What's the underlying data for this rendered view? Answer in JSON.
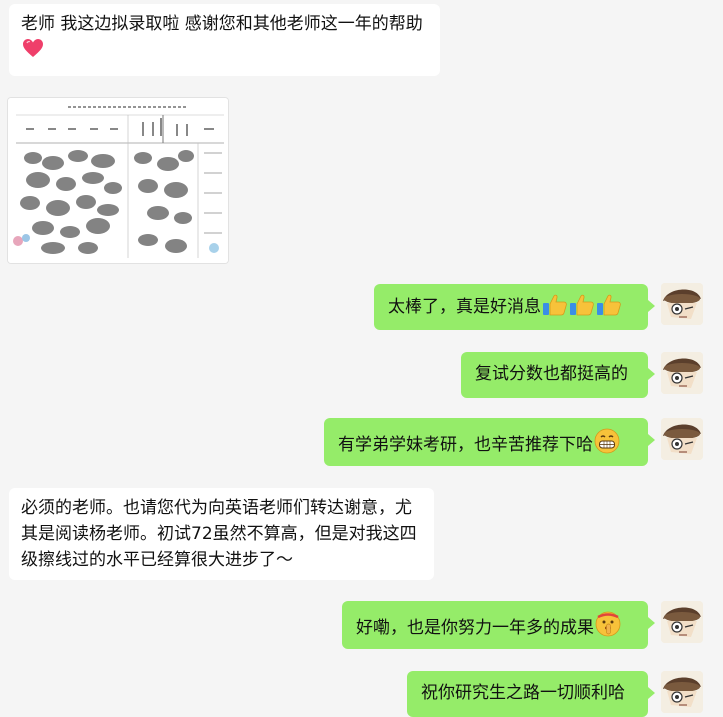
{
  "chat": {
    "messages": [
      {
        "side": "left",
        "text": "老师 我这边拟录取啦 感谢您和其他老师这一年的帮助",
        "emoji": "heart-icon"
      },
      {
        "side": "left",
        "type": "image",
        "image": "document-scan-thumbnail"
      },
      {
        "side": "right",
        "text": "太棒了，真是好消息",
        "emoji": "thumbs-up-icon x3"
      },
      {
        "side": "right",
        "text": "复试分数也都挺高的"
      },
      {
        "side": "right",
        "text": "有学弟学妹考研，也辛苦推荐下哈",
        "emoji": "grinning-face-icon"
      },
      {
        "side": "left",
        "text": "必须的老师。也请您代为向英语老师们转达谢意，尤其是阅读杨老师。初试72虽然不算高，但是对我这四级擦线过的水平已经算很大进步了～"
      },
      {
        "side": "right",
        "text": "好嘞，也是你努力一年多的成果",
        "emoji": "shushing-face-icon"
      },
      {
        "side": "right",
        "text": "祝你研究生之路一切顺利哈"
      }
    ]
  },
  "colors": {
    "background": "#f5f5f5",
    "incoming_bubble": "#ffffff",
    "outgoing_bubble": "#95ec69"
  }
}
